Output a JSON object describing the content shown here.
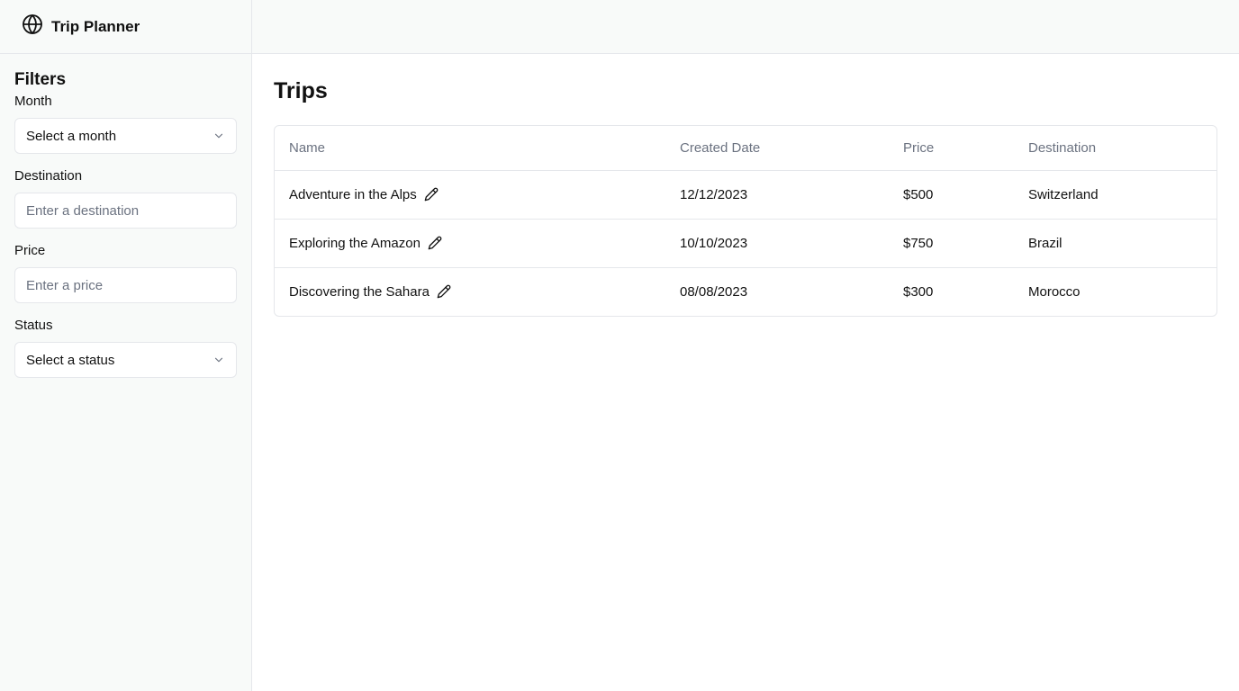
{
  "app": {
    "title": "Trip Planner",
    "logo_icon": "globe-icon"
  },
  "filters": {
    "title": "Filters",
    "month": {
      "label": "Month",
      "value": "Select a month"
    },
    "destination": {
      "label": "Destination",
      "placeholder": "Enter a destination"
    },
    "price": {
      "label": "Price",
      "placeholder": "Enter a price"
    },
    "status": {
      "label": "Status",
      "value": "Select a status"
    }
  },
  "main": {
    "title": "Trips",
    "table": {
      "headers": [
        "Name",
        "Created Date",
        "Price",
        "Destination"
      ],
      "rows": [
        {
          "name": "Adventure in the Alps",
          "created": "12/12/2023",
          "price": "$500",
          "destination": "Switzerland"
        },
        {
          "name": "Exploring the Amazon",
          "created": "10/10/2023",
          "price": "$750",
          "destination": "Brazil"
        },
        {
          "name": "Discovering the Sahara",
          "created": "08/08/2023",
          "price": "$300",
          "destination": "Morocco"
        }
      ]
    }
  },
  "colors": {
    "sidebar_bg": "#f8faf9",
    "border": "#e5e7eb",
    "muted_text": "#6b7280"
  }
}
